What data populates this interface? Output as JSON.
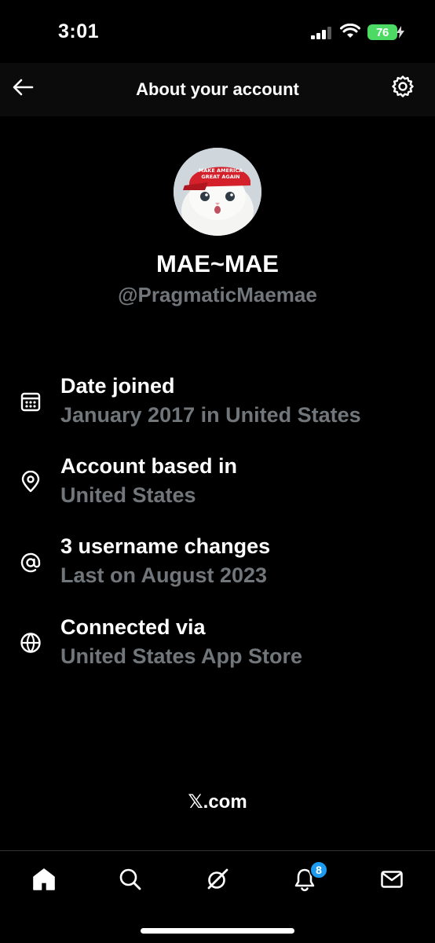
{
  "status_bar": {
    "time": "3:01",
    "battery": "76"
  },
  "header": {
    "title": "About your account",
    "back_icon": "arrow-left-icon",
    "settings_icon": "gear-icon"
  },
  "profile": {
    "display_name": "MAE~MAE",
    "handle": "@PragmaticMaemae",
    "avatar_hat_text": [
      "MAKE AMERICA",
      "GREAT AGAIN"
    ]
  },
  "info": [
    {
      "icon": "calendar-icon",
      "title": "Date joined",
      "value": "January 2017 in United States"
    },
    {
      "icon": "location-pin-icon",
      "title": "Account based in",
      "value": "United States"
    },
    {
      "icon": "at-sign-icon",
      "title": "3 username changes",
      "value": "Last on August 2023"
    },
    {
      "icon": "globe-icon",
      "title": "Connected via",
      "value": "United States App Store"
    }
  ],
  "footer": {
    "brand_glyph": "𝕏",
    "brand_suffix": ".com"
  },
  "tabs": [
    {
      "name": "home",
      "icon": "home-icon"
    },
    {
      "name": "search",
      "icon": "search-icon"
    },
    {
      "name": "grok",
      "icon": "grok-icon"
    },
    {
      "name": "notifications",
      "icon": "bell-icon",
      "badge": "8"
    },
    {
      "name": "messages",
      "icon": "mail-icon"
    }
  ],
  "colors": {
    "background": "#000000",
    "text_primary": "#ffffff",
    "text_secondary": "#71767b",
    "accent": "#1d9bf0",
    "battery": "#4cd964"
  }
}
